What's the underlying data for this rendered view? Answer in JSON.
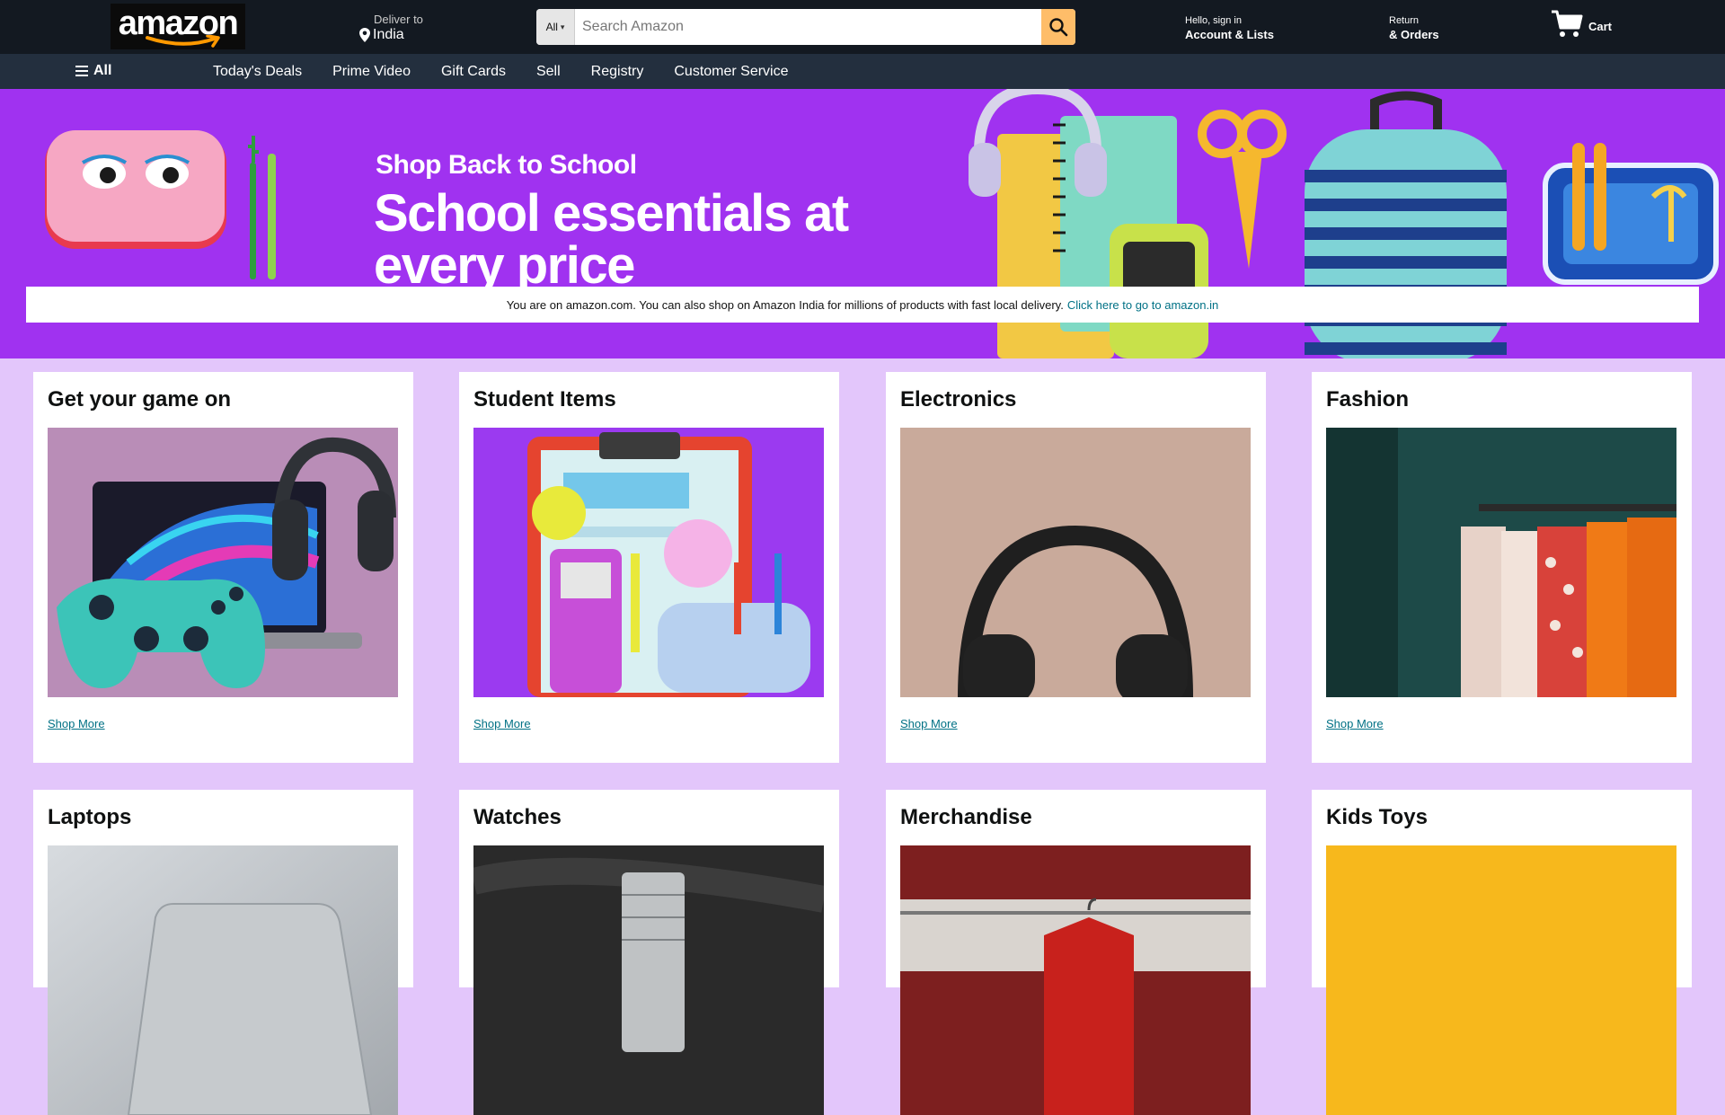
{
  "header": {
    "logo_text": "amazon",
    "deliver": {
      "line1": "Deliver to",
      "line2": "India"
    },
    "search": {
      "category": "All",
      "placeholder": "Search Amazon"
    },
    "account": {
      "line1": "Hello, sign in",
      "line2": "Account & Lists"
    },
    "orders": {
      "line1": "Return",
      "line2": "& Orders"
    },
    "cart": {
      "label": "Cart"
    }
  },
  "nav": {
    "all_label": "All",
    "links": [
      "Today's Deals",
      "Prime Video",
      "Gift Cards",
      "Sell",
      "Registry",
      "Customer Service"
    ]
  },
  "hero": {
    "kicker": "Shop Back to School",
    "headline": "School essentials at every price"
  },
  "notice": {
    "text": "You are on amazon.com. You can also shop on Amazon India for millions of products with fast local delivery.",
    "link": "Click here to go to amazon.in"
  },
  "cards": [
    {
      "title": "Get your game on",
      "link": "Shop More"
    },
    {
      "title": "Student Items",
      "link": "Shop More"
    },
    {
      "title": "Electronics",
      "link": "Shop More"
    },
    {
      "title": "Fashion",
      "link": "Shop More"
    },
    {
      "title": "Laptops"
    },
    {
      "title": "Watches"
    },
    {
      "title": "Merchandise"
    },
    {
      "title": "Kids Toys"
    }
  ],
  "colors": {
    "header_bg": "#131921",
    "nav_bg": "#232f3e",
    "search_button": "#febd69",
    "hero_bg": "#a032f0",
    "page_bg": "#e3c6fb",
    "link": "#007185"
  }
}
